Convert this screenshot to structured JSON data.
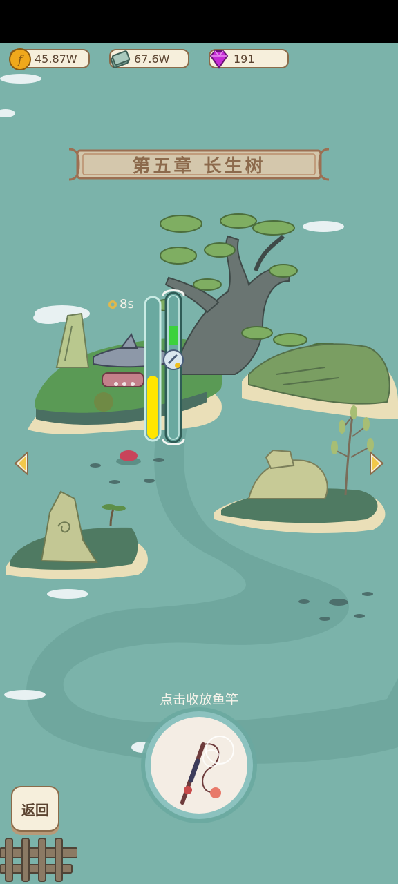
{
  "resources": {
    "coins": {
      "value": "45.87W",
      "icon": "coin-icon",
      "color": "#f0a81c"
    },
    "cash": {
      "value": "67.6W",
      "icon": "cash-stack-icon",
      "color": "#7fa89a"
    },
    "gems": {
      "value": "191",
      "icon": "gem-icon",
      "color": "#c52bd6"
    }
  },
  "chapter": {
    "title": "第五章   长生树"
  },
  "fishing": {
    "timer": "8s",
    "tension_level": 0.45,
    "catch_progress": 0.1,
    "hint": "点击收放鱼竿"
  },
  "nav": {
    "back_label": "返回"
  },
  "colors": {
    "water": "#7bb3aa",
    "tension_fill": "#ffe600",
    "catch_fill": "#3cd23c",
    "panel": "#f6efdc",
    "border": "#8b6b4a"
  }
}
